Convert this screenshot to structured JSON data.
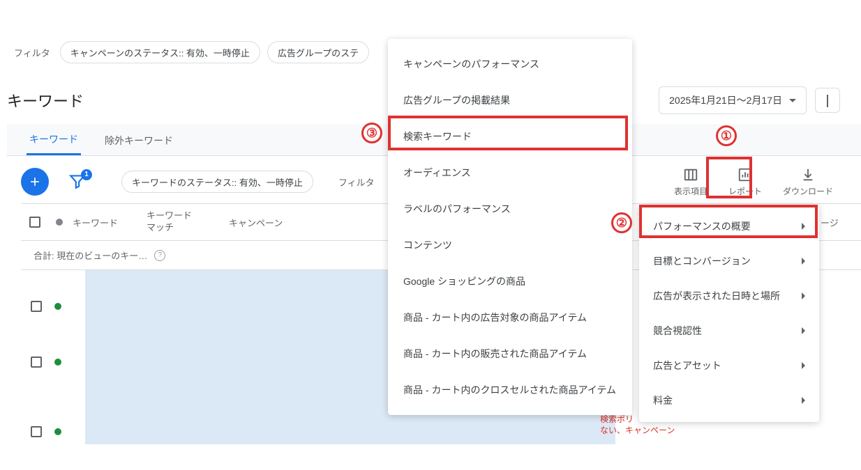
{
  "filters": {
    "label": "フィルタ",
    "chip_campaign": "キャンペーンのステータス:: 有効、一時停止",
    "chip_adgroup": "広告グループのステ"
  },
  "page": {
    "title": "キーワード"
  },
  "date": {
    "range": "2025年1月21日～2月17日"
  },
  "tabs": {
    "keywords": "キーワード",
    "neg_keywords": "除外キーワード"
  },
  "toolbar": {
    "kw_status_chip": "キーワードのステータス:: 有効、一時停止",
    "filter_label": "フィルタ",
    "funnel_badge": "1",
    "columns_label": "表示項目",
    "report_label": "レポート",
    "download_label": "ダウンロード"
  },
  "table": {
    "col_keyword": "キーワード",
    "col_match": "キーワード\nマッチ",
    "col_campaign": "キャンペーン",
    "col_right_snippet": "ージ",
    "summary": "合計: 現在のビューのキー…"
  },
  "policy": {
    "line1": "検索ポリ",
    "line2": "ない、キャンペーン"
  },
  "menu_left": {
    "items": [
      "キャンペーンのパフォーマンス",
      "広告グループの掲載結果",
      "検索キーワード",
      "オーディエンス",
      "ラベルのパフォーマンス",
      "コンテンツ",
      "Google ショッピングの商品",
      "商品 - カート内の広告対象の商品アイテム",
      "商品 - カート内の販売された商品アイテム",
      "商品 - カート内のクロスセルされた商品アイテム"
    ]
  },
  "menu_right": {
    "items": [
      "パフォーマンスの概要",
      "目標とコンバージョン",
      "広告が表示された日時と場所",
      "競合視認性",
      "広告とアセット",
      "料金"
    ]
  },
  "annotations": {
    "n1": "①",
    "n2": "②",
    "n3": "③"
  }
}
